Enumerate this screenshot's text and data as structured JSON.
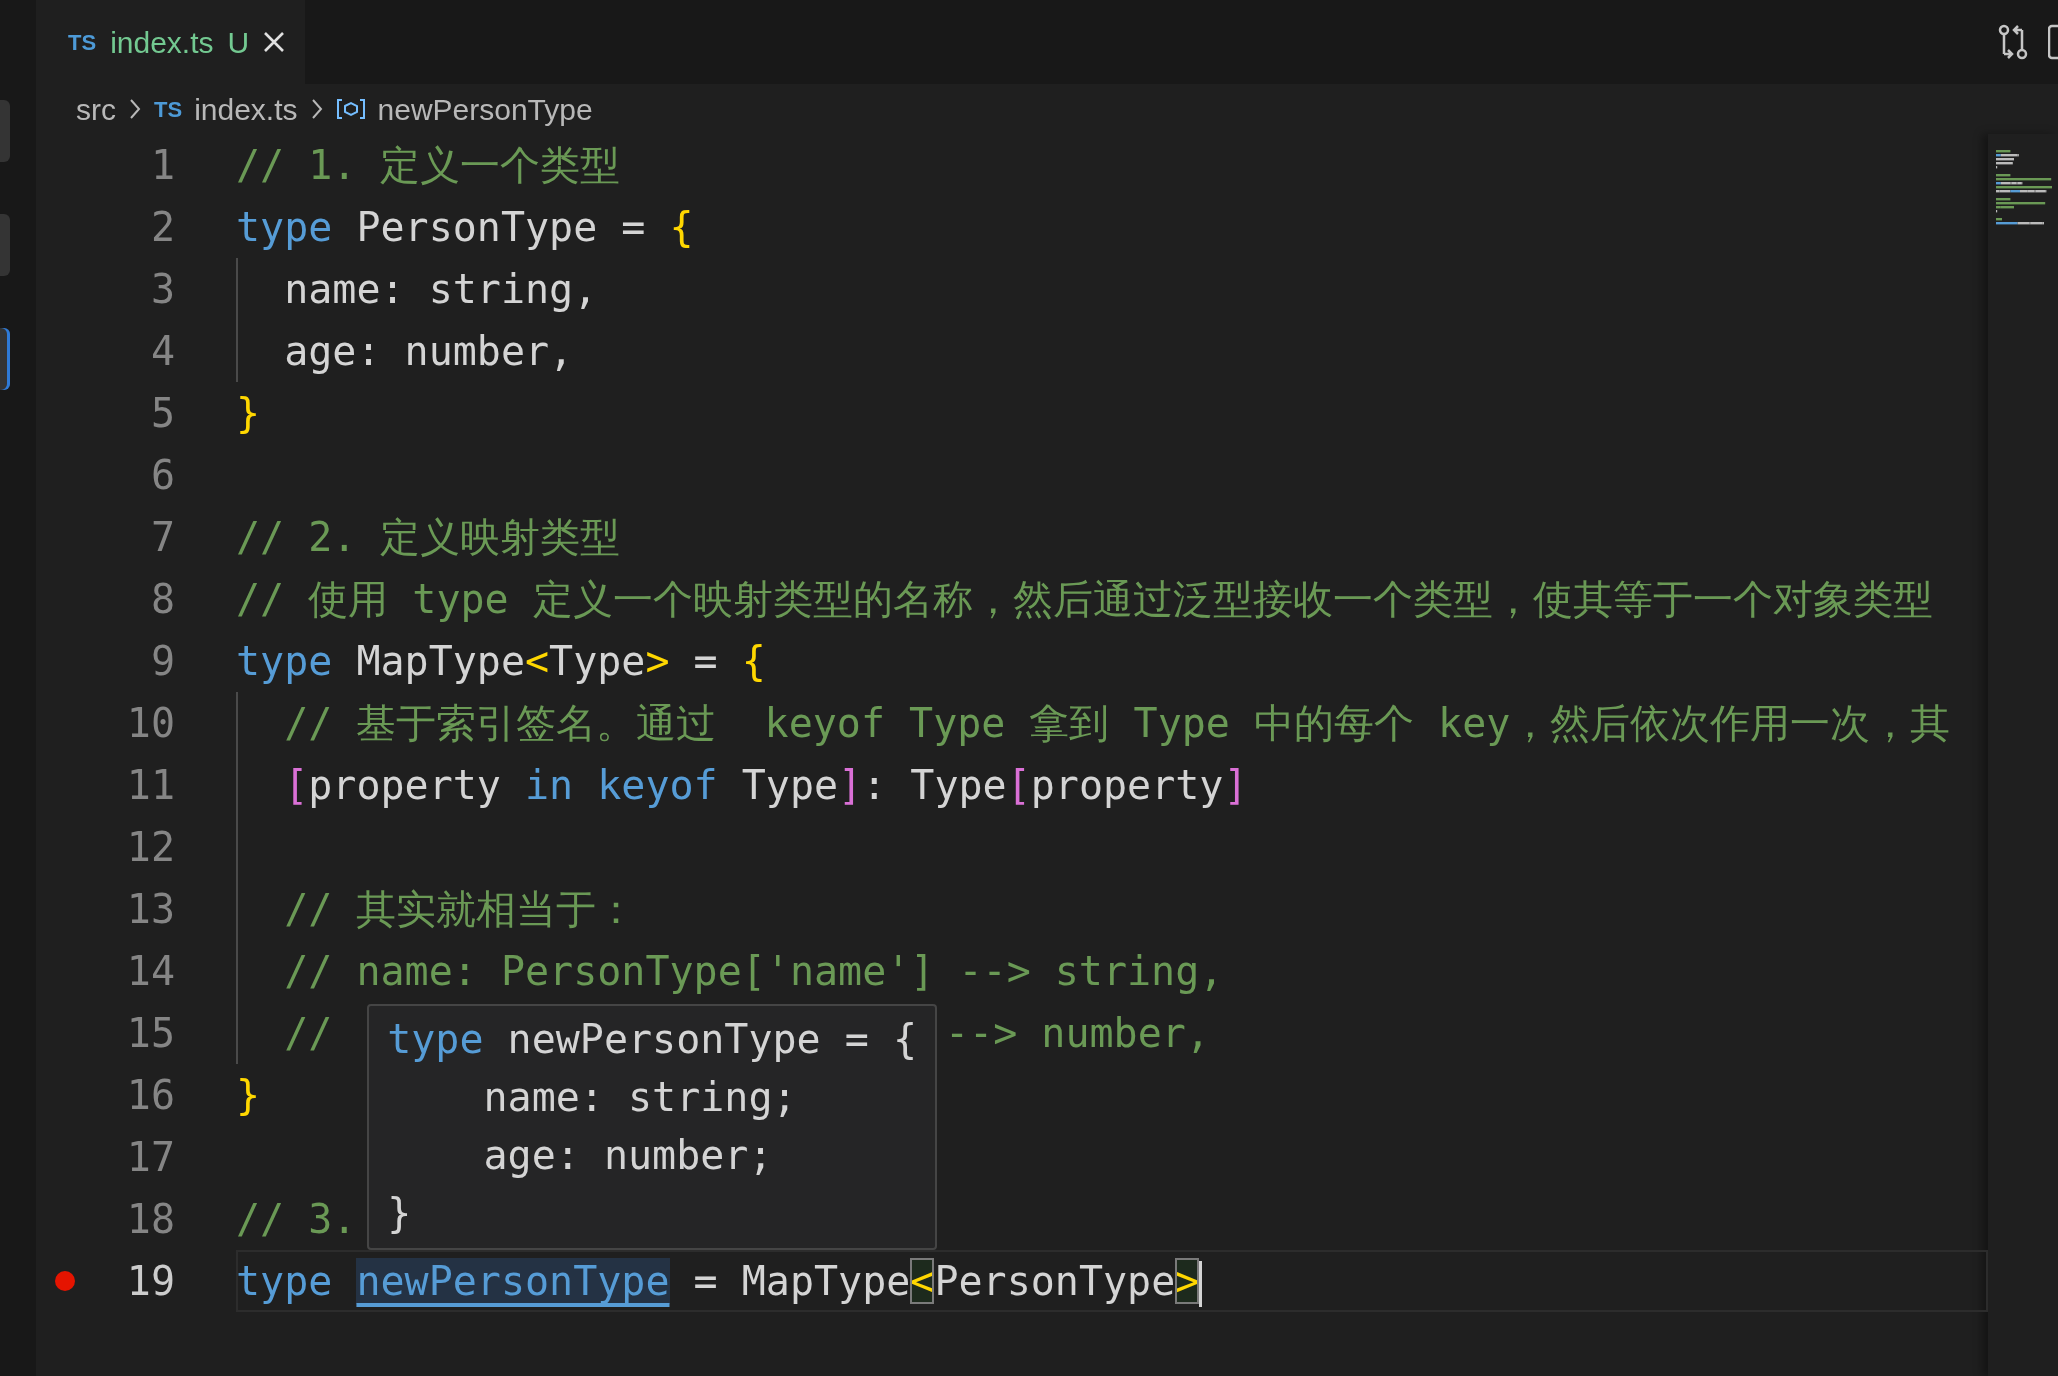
{
  "left_edge_items": [
    {
      "selected": false
    },
    {
      "selected": false
    },
    {
      "selected": true
    }
  ],
  "tab": {
    "badge": "TS",
    "filename": "index.ts",
    "status": "U",
    "selected": true
  },
  "breadcrumb": [
    {
      "kind": "folder",
      "label": "src"
    },
    {
      "kind": "file",
      "badge": "TS",
      "label": "index.ts"
    },
    {
      "kind": "symbol",
      "label": "newPersonType"
    }
  ],
  "lines": [
    {
      "number": "1",
      "indent_guide": false,
      "current": false,
      "breakpoint": false,
      "tokens": [
        {
          "kind": "comment",
          "text": "// 1. 定义一个类型"
        }
      ]
    },
    {
      "number": "2",
      "indent_guide": false,
      "current": false,
      "breakpoint": false,
      "tokens": [
        {
          "kind": "keyword",
          "text": "type"
        },
        {
          "kind": "text",
          "text": " PersonType = "
        },
        {
          "kind": "brace",
          "text": "{"
        }
      ]
    },
    {
      "number": "3",
      "indent_guide": true,
      "current": false,
      "breakpoint": false,
      "tokens": [
        {
          "kind": "text",
          "text": "  name: string,"
        }
      ]
    },
    {
      "number": "4",
      "indent_guide": true,
      "current": false,
      "breakpoint": false,
      "tokens": [
        {
          "kind": "text",
          "text": "  age: number,"
        }
      ]
    },
    {
      "number": "5",
      "indent_guide": false,
      "current": false,
      "breakpoint": false,
      "tokens": [
        {
          "kind": "brace",
          "text": "}"
        }
      ]
    },
    {
      "number": "6",
      "indent_guide": false,
      "current": false,
      "breakpoint": false
    },
    {
      "number": "7",
      "indent_guide": false,
      "current": false,
      "breakpoint": false,
      "tokens": [
        {
          "kind": "comment",
          "text": "// 2. 定义映射类型"
        }
      ]
    },
    {
      "number": "8",
      "indent_guide": false,
      "current": false,
      "breakpoint": false,
      "tokens": [
        {
          "kind": "comment",
          "text": "// 使用 type 定义一个映射类型的名称，然后通过泛型接收一个类型，使其等于一个对象类型"
        }
      ]
    },
    {
      "number": "9",
      "indent_guide": false,
      "current": false,
      "breakpoint": false,
      "tokens": [
        {
          "kind": "keyword",
          "text": "type"
        },
        {
          "kind": "text",
          "text": " MapType"
        },
        {
          "kind": "angle",
          "text": "<",
          "matched": false
        },
        {
          "kind": "text",
          "text": "Type"
        },
        {
          "kind": "angle",
          "text": ">",
          "matched": false
        },
        {
          "kind": "text",
          "text": " = "
        },
        {
          "kind": "brace",
          "text": "{"
        }
      ]
    },
    {
      "number": "10",
      "indent_guide": true,
      "current": false,
      "breakpoint": false,
      "tokens": [
        {
          "kind": "comment",
          "text": "  // 基于索引签名。通过  keyof Type 拿到 Type 中的每个 key，然后依次作用一次，其"
        }
      ]
    },
    {
      "number": "11",
      "indent_guide": true,
      "current": false,
      "breakpoint": false,
      "tokens": [
        {
          "kind": "bracket",
          "text": "  ["
        },
        {
          "kind": "text",
          "text": "property "
        },
        {
          "kind": "keyword",
          "text": "in keyof"
        },
        {
          "kind": "text",
          "text": " Type"
        },
        {
          "kind": "bracket",
          "text": "]"
        },
        {
          "kind": "text",
          "text": ": Type"
        },
        {
          "kind": "bracket",
          "text": "["
        },
        {
          "kind": "text",
          "text": "property"
        },
        {
          "kind": "bracket",
          "text": "]"
        }
      ]
    },
    {
      "number": "12",
      "indent_guide": true,
      "current": false,
      "breakpoint": false
    },
    {
      "number": "13",
      "indent_guide": true,
      "current": false,
      "breakpoint": false,
      "tokens": [
        {
          "kind": "comment",
          "text": "  // 其实就相当于："
        }
      ]
    },
    {
      "number": "14",
      "indent_guide": true,
      "current": false,
      "breakpoint": false,
      "tokens": [
        {
          "kind": "comment",
          "text": "  // name: PersonType['name'] --> string,"
        }
      ]
    },
    {
      "number": "15",
      "indent_guide": true,
      "current": false,
      "breakpoint": false,
      "tokens": [
        {
          "kind": "comment",
          "text": "  //"
        },
        {
          "kind": "comment",
          "text": "--> number,",
          "after_popup": true
        }
      ]
    },
    {
      "number": "16",
      "indent_guide": false,
      "current": false,
      "breakpoint": false,
      "tokens": [
        {
          "kind": "brace",
          "text": "}"
        }
      ]
    },
    {
      "number": "17",
      "indent_guide": false,
      "current": false,
      "breakpoint": false
    },
    {
      "number": "18",
      "indent_guide": false,
      "current": false,
      "breakpoint": false,
      "tokens": [
        {
          "kind": "comment",
          "text": "// 3."
        }
      ]
    },
    {
      "number": "19",
      "indent_guide": false,
      "current": true,
      "breakpoint": true,
      "tokens": [
        {
          "kind": "keyword",
          "text": "type "
        },
        {
          "kind": "reference",
          "text": "newPersonType"
        },
        {
          "kind": "text",
          "text": " = MapType"
        },
        {
          "kind": "angle",
          "text": "<",
          "matched": true
        },
        {
          "kind": "text",
          "text": "PersonType"
        },
        {
          "kind": "angle",
          "text": ">",
          "matched": true
        }
      ]
    }
  ],
  "hover": {
    "lines": [
      [
        {
          "kind": "keyword",
          "text": "type"
        },
        {
          "kind": "text",
          "text": " newPersonType = {"
        }
      ],
      [
        {
          "kind": "text",
          "text": "    name: string;"
        }
      ],
      [
        {
          "kind": "text",
          "text": "    age: number;"
        }
      ],
      [
        {
          "kind": "text",
          "text": "}"
        }
      ]
    ]
  }
}
